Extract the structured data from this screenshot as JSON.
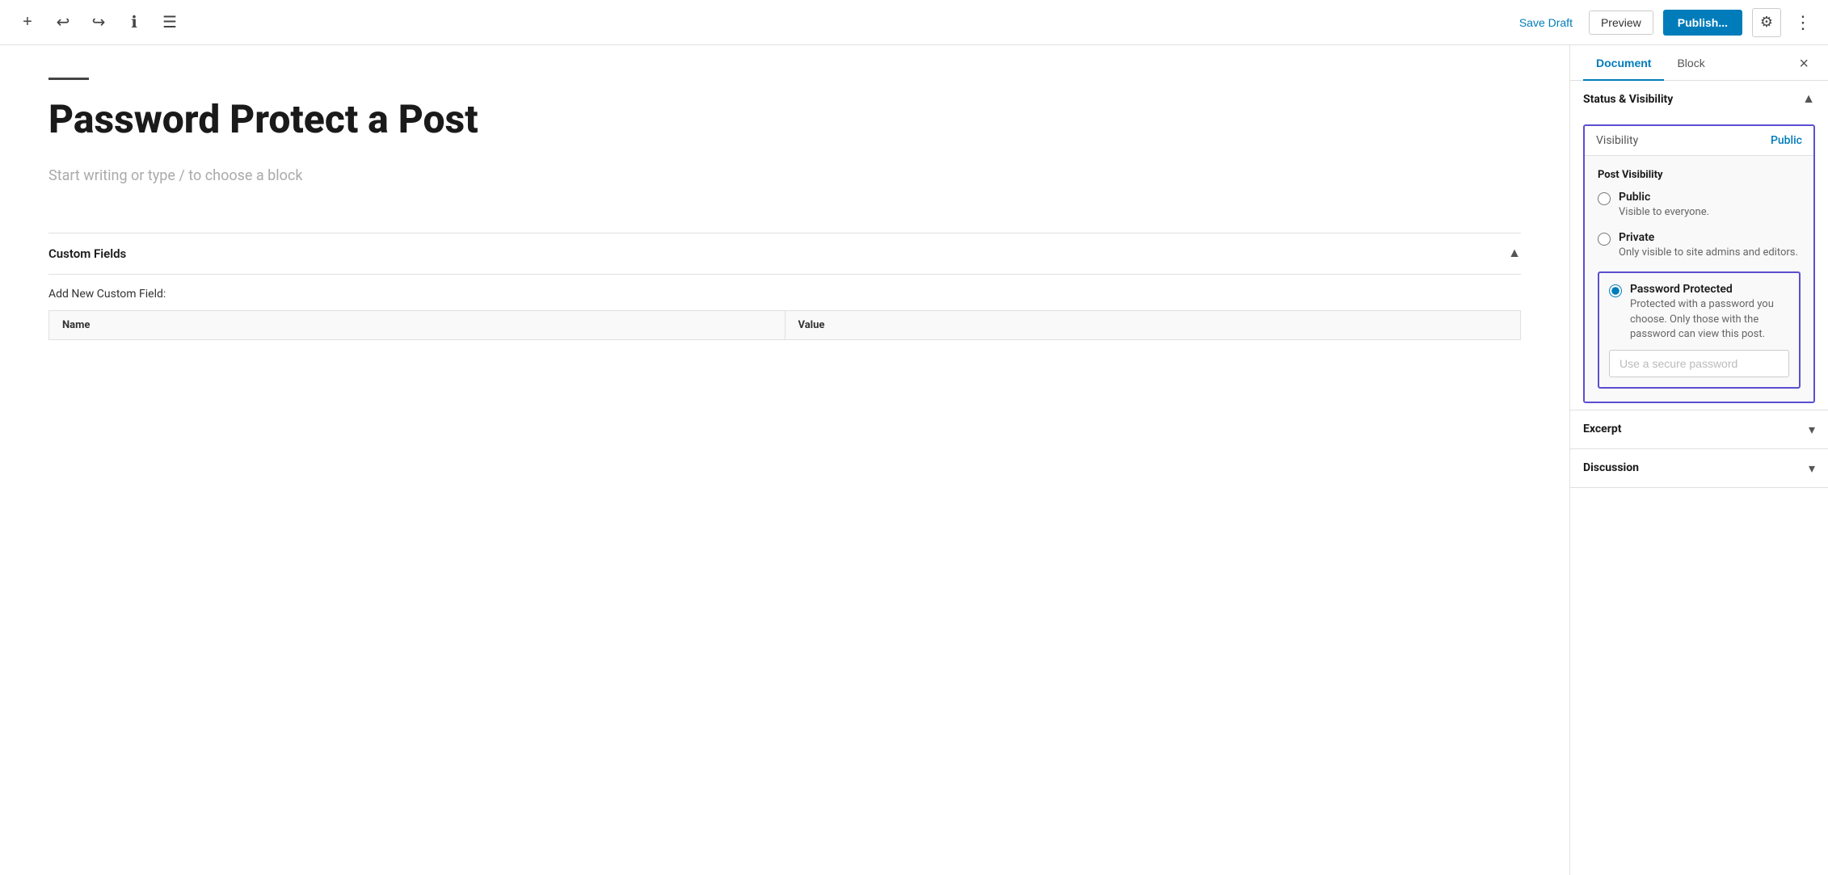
{
  "toolbar": {
    "save_draft_label": "Save Draft",
    "preview_label": "Preview",
    "publish_label": "Publish...",
    "icons": {
      "add": "+",
      "undo": "↩",
      "redo": "↪",
      "info": "ℹ",
      "menu": "☰",
      "settings": "⚙",
      "more": "⋮"
    }
  },
  "editor": {
    "title_divider_visible": true,
    "post_title": "Password Protect a Post",
    "placeholder": "Start writing or type / to choose a block",
    "custom_fields": {
      "title": "Custom Fields",
      "add_new_label": "Add New Custom Field:",
      "columns": [
        "Name",
        "Value"
      ]
    }
  },
  "sidebar": {
    "tabs": [
      {
        "label": "Document",
        "active": true
      },
      {
        "label": "Block",
        "active": false
      }
    ],
    "close_label": "×",
    "status_visibility": {
      "title": "Status & Visibility",
      "visibility_label": "Visibility",
      "visibility_value": "Public",
      "post_visibility": {
        "title": "Post Visibility",
        "options": [
          {
            "id": "public",
            "label": "Public",
            "desc": "Visible to everyone.",
            "checked": false
          },
          {
            "id": "private",
            "label": "Private",
            "desc": "Only visible to site admins and editors.",
            "checked": false
          },
          {
            "id": "password",
            "label": "Password Protected",
            "desc": "Protected with a password you choose. Only those with the password can view this post.",
            "checked": true
          }
        ],
        "password_placeholder": "Use a secure password"
      }
    },
    "excerpt": {
      "title": "Excerpt",
      "collapsed": true
    },
    "discussion": {
      "title": "Discussion",
      "collapsed": true
    }
  }
}
